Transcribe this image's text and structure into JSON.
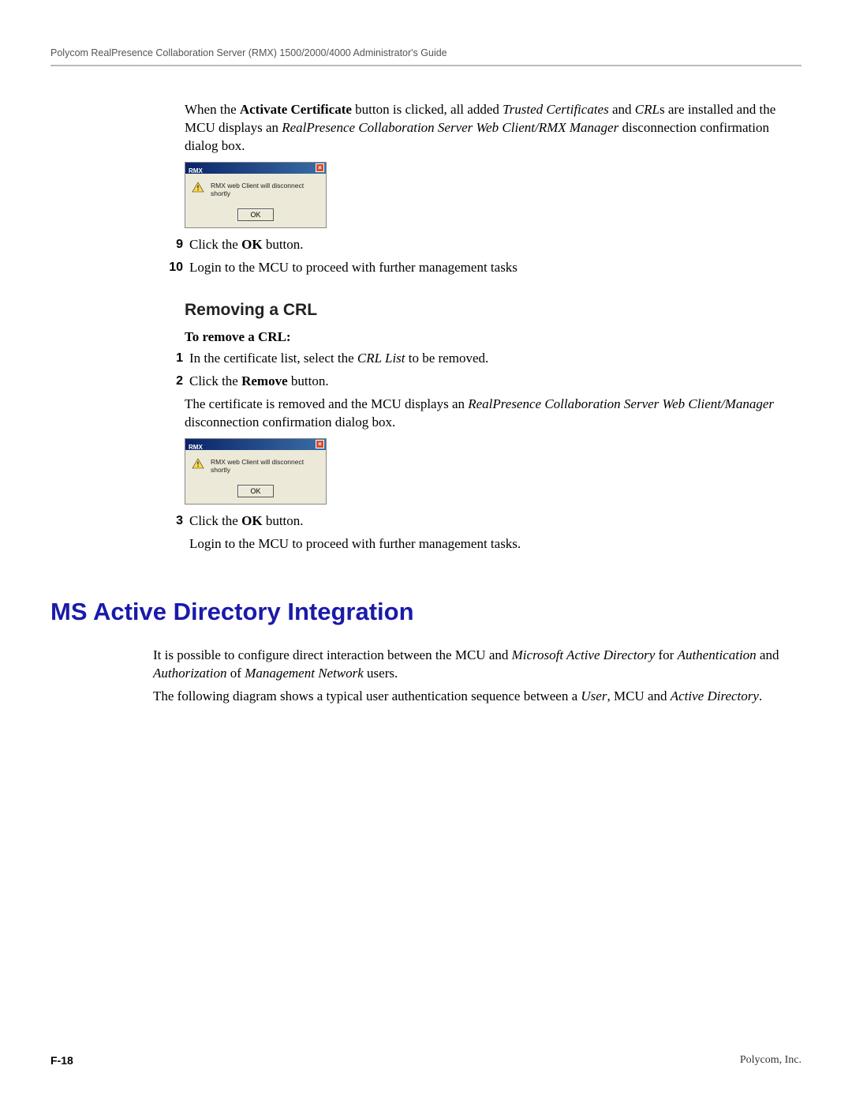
{
  "header": "Polycom RealPresence Collaboration Server (RMX) 1500/2000/4000 Administrator's Guide",
  "p1": {
    "a": "When the ",
    "b": "Activate Certificate",
    "c": " button is clicked, all added ",
    "d": "Trusted Certificates",
    "e": " and ",
    "f": "CRL",
    "g": "s are installed and the MCU displays an ",
    "h": "RealPresence Collaboration Server Web Client/RMX Manager",
    "i": " disconnection confirmation dialog box."
  },
  "dialog1": {
    "title": "RMX",
    "msg": "RMX web Client will disconnect shortly",
    "ok": "OK"
  },
  "listA": {
    "n9": "9",
    "t9a": "Click the ",
    "t9b": "OK",
    "t9c": " button.",
    "n10": "10",
    "t10": "Login to the MCU to proceed with further management tasks"
  },
  "h2": "Removing a CRL",
  "subhead": "To remove a CRL:",
  "listB": {
    "n1": "1",
    "t1a": "In the certificate list, select the ",
    "t1b": "CRL List",
    "t1c": " to be removed.",
    "n2": "2",
    "t2a": "Click the ",
    "t2b": "Remove",
    "t2c": " button."
  },
  "p2": {
    "a": "The certificate is removed and the MCU displays an ",
    "b": "RealPresence Collaboration Server Web Client/Manager",
    "c": " disconnection confirmation dialog box."
  },
  "dialog2": {
    "title": "RMX",
    "msg": "RMX web Client will disconnect shortly",
    "ok": "OK"
  },
  "listC": {
    "n3": "3",
    "t3a": "Click the ",
    "t3b": "OK",
    "t3c": " button."
  },
  "p3": "Login to the MCU to proceed with further management tasks.",
  "h1": "MS Active Directory Integration",
  "p4": {
    "a": "It is possible to configure direct interaction between the MCU and ",
    "b": "Microsoft Active Directory",
    "c": " for ",
    "d": "Authentication",
    "e": " and ",
    "f": "Authorization",
    "g": " of ",
    "h": "Management Network",
    "i": " users."
  },
  "p5": {
    "a": "The following diagram shows a typical user authentication sequence between a ",
    "b": "User",
    "c": ", MCU and ",
    "d": "Active Directory",
    "e": "."
  },
  "footer": {
    "left": "F-18",
    "right": "Polycom, Inc."
  }
}
